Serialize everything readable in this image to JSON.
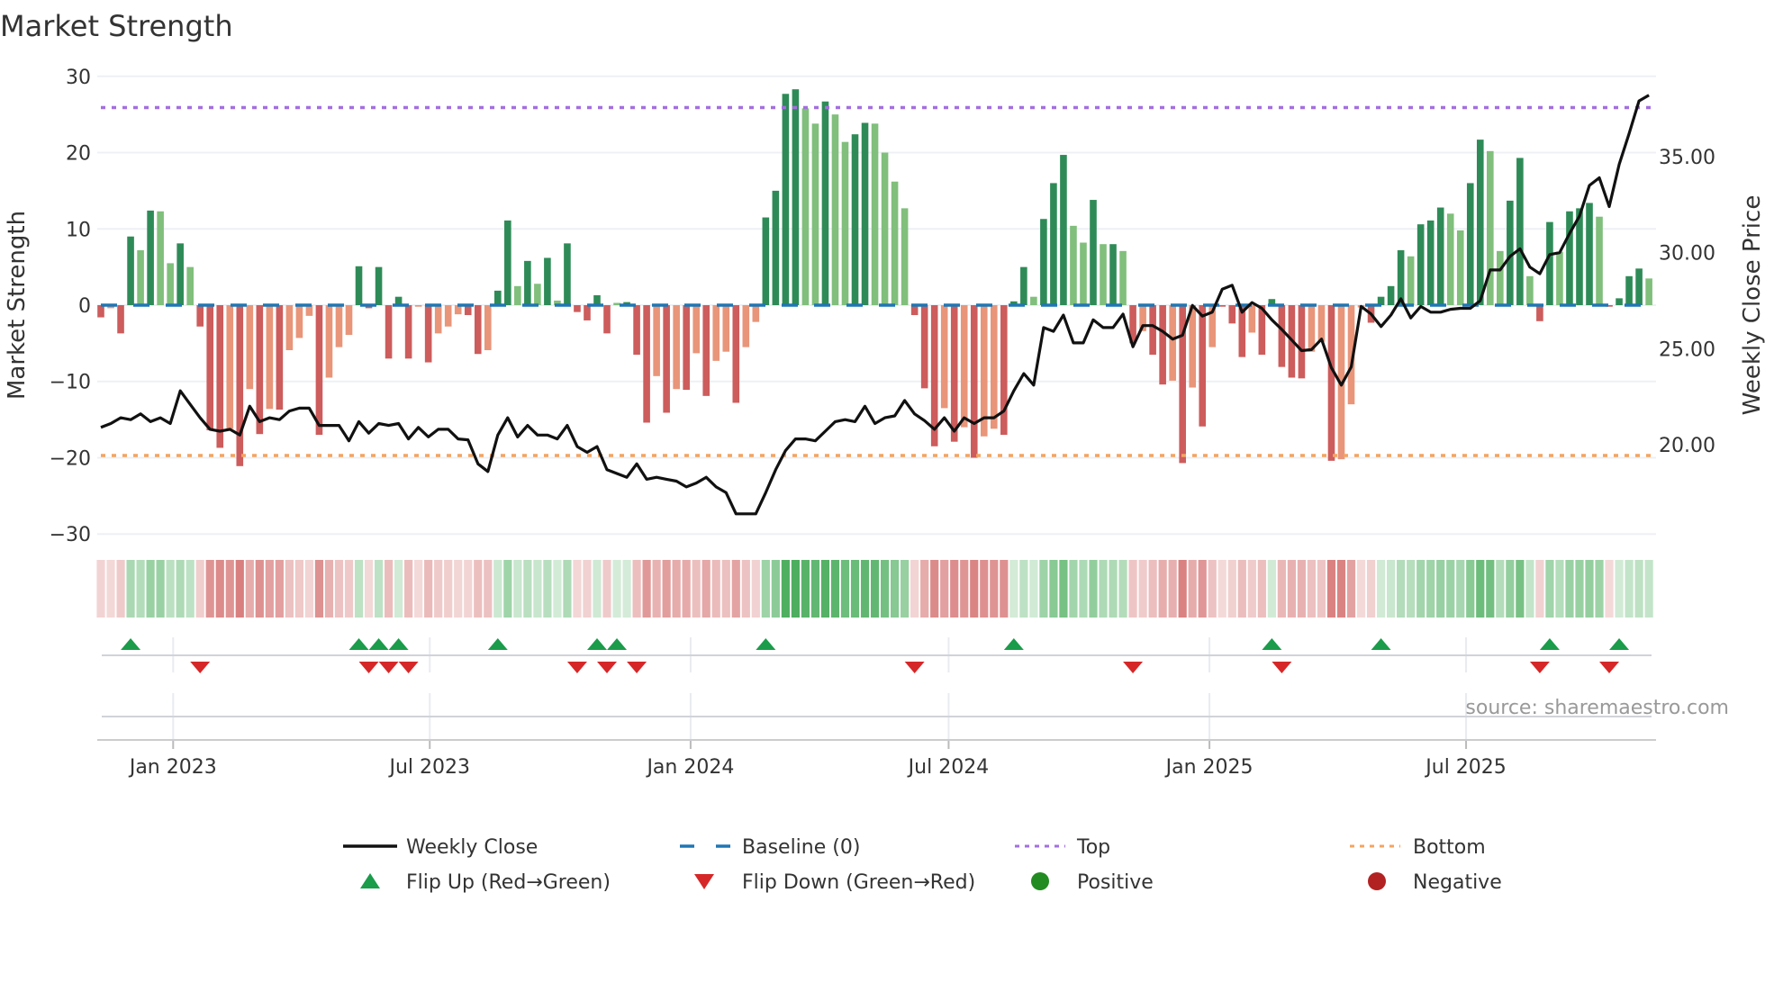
{
  "title": "Market Strength",
  "source": "source: sharemaestro.com",
  "colors": {
    "strong_positive": "#2e8b57",
    "weak_positive": "#80bf7c",
    "strong_negative": "#cd5c5c",
    "weak_negative": "#e8957a",
    "close_line": "#111111",
    "baseline": "#1f77b4",
    "top": "#a36fe0",
    "bottom": "#f4a460",
    "flip_up": "#1a9c4a",
    "flip_down": "#d62728",
    "positive": "#228b22",
    "negative": "#b22222",
    "heat_positive": "#2ea043",
    "heat_negative": "#c84646"
  },
  "legend": [
    {
      "key": "weekly-close",
      "label": "Weekly Close"
    },
    {
      "key": "baseline",
      "label": "Baseline (0)"
    },
    {
      "key": "top",
      "label": "Top"
    },
    {
      "key": "bottom",
      "label": "Bottom"
    },
    {
      "key": "flip-up",
      "label": "Flip Up (Red→Green)"
    },
    {
      "key": "flip-down",
      "label": "Flip Down (Green→Red)"
    },
    {
      "key": "positive",
      "label": "Positive"
    },
    {
      "key": "negative",
      "label": "Negative"
    }
  ],
  "chart_data": {
    "type": "bar",
    "title": "Market Strength",
    "ylabel": "Market Strength",
    "ylabel_right": "Weekly Close Price",
    "start_date": "2022-11-11",
    "frequency": "weekly",
    "ylim": [
      -30.8,
      30.8
    ],
    "ylim_right": [
      15.03,
      39.5
    ],
    "grid": true,
    "legend_position": "bottom",
    "yticks": [
      {
        "value": 30,
        "label": "30"
      },
      {
        "value": 20,
        "label": "20"
      },
      {
        "value": 10,
        "label": "10"
      },
      {
        "value": 0,
        "label": "0"
      },
      {
        "value": -10,
        "label": "−10"
      },
      {
        "value": -20,
        "label": "−20"
      },
      {
        "value": -30,
        "label": "−30"
      }
    ],
    "yticks_right": [
      {
        "value": 35,
        "label": "35.00"
      },
      {
        "value": 30,
        "label": "30.00"
      },
      {
        "value": 25,
        "label": "25.00"
      },
      {
        "value": 20,
        "label": "20.00"
      }
    ],
    "xticks": [
      {
        "date": "2023-01-01",
        "label": "Jan 2023"
      },
      {
        "date": "2023-07-01",
        "label": "Jul 2023"
      },
      {
        "date": "2024-01-01",
        "label": "Jan 2024"
      },
      {
        "date": "2024-07-01",
        "label": "Jul 2024"
      },
      {
        "date": "2025-01-01",
        "label": "Jan 2025"
      },
      {
        "date": "2025-07-01",
        "label": "Jul 2025"
      }
    ],
    "baseline": 0,
    "top_level": 25.9,
    "bottom_level": -19.7,
    "series": [
      {
        "name": "Market Strength",
        "type": "bar",
        "axis": "left",
        "values": [
          -1.6,
          -0.4,
          -3.7,
          9.0,
          7.2,
          12.4,
          12.3,
          5.5,
          8.1,
          5.0,
          -2.8,
          -16.4,
          -18.7,
          -16.2,
          -21.1,
          -11.0,
          -16.9,
          -13.6,
          -13.7,
          -5.9,
          -4.3,
          -1.4,
          -17.0,
          -9.5,
          -5.5,
          -3.9,
          5.1,
          -0.4,
          5.0,
          -7.0,
          1.1,
          -7.0,
          -0.2,
          -7.5,
          -3.7,
          -2.8,
          -1.2,
          -1.3,
          -6.4,
          -5.9,
          1.9,
          11.1,
          2.5,
          5.8,
          2.8,
          6.2,
          0.6,
          8.1,
          -0.9,
          -2.0,
          1.3,
          -3.7,
          0.3,
          0.4,
          -6.5,
          -15.4,
          -9.3,
          -14.1,
          -11.0,
          -11.1,
          -6.3,
          -11.9,
          -7.3,
          -6.1,
          -12.8,
          -5.5,
          -2.2,
          11.5,
          15.0,
          27.7,
          28.3,
          25.8,
          23.8,
          26.7,
          25.0,
          21.4,
          22.4,
          23.9,
          23.8,
          20.0,
          16.2,
          12.7,
          -1.3,
          -10.9,
          -18.5,
          -13.5,
          -17.9,
          -16.0,
          -20.0,
          -17.2,
          -16.2,
          -17.0,
          0.5,
          5.0,
          1.1,
          11.3,
          16.0,
          19.7,
          10.4,
          8.2,
          13.8,
          8.0,
          8.0,
          7.1,
          -5.0,
          -3.4,
          -6.5,
          -10.4,
          -9.9,
          -20.7,
          -10.8,
          -15.9,
          -5.5,
          -0.2,
          -2.4,
          -6.8,
          -3.6,
          -6.5,
          0.8,
          -8.1,
          -9.5,
          -9.6,
          -6.1,
          -4.8,
          -20.4,
          -20.2,
          -13.0,
          -0.3,
          -2.3,
          1.1,
          2.5,
          7.2,
          6.4,
          10.6,
          11.1,
          12.8,
          12.0,
          9.8,
          16.0,
          21.7,
          20.2,
          7.1,
          13.7,
          19.3,
          3.8,
          -2.1,
          10.9,
          7.0,
          12.3,
          12.7,
          13.4,
          11.6,
          -0.2,
          0.9,
          3.8,
          4.8,
          3.5
        ],
        "strong": [
          1,
          0,
          1,
          1,
          0,
          1,
          0,
          0,
          1,
          0,
          1,
          1,
          1,
          0,
          1,
          0,
          1,
          0,
          1,
          0,
          0,
          0,
          1,
          0,
          0,
          0,
          1,
          1,
          1,
          1,
          1,
          1,
          0,
          1,
          0,
          0,
          0,
          1,
          1,
          0,
          1,
          1,
          0,
          1,
          0,
          1,
          0,
          1,
          1,
          1,
          1,
          1,
          0,
          1,
          1,
          1,
          0,
          1,
          0,
          1,
          0,
          1,
          0,
          0,
          1,
          0,
          0,
          1,
          1,
          1,
          1,
          0,
          0,
          1,
          0,
          0,
          1,
          1,
          0,
          0,
          0,
          0,
          1,
          1,
          1,
          0,
          1,
          0,
          1,
          0,
          0,
          1,
          1,
          1,
          0,
          1,
          1,
          1,
          0,
          0,
          1,
          0,
          1,
          0,
          1,
          0,
          1,
          1,
          0,
          1,
          0,
          1,
          0,
          1,
          1,
          1,
          0,
          1,
          1,
          1,
          1,
          1,
          0,
          0,
          1,
          0,
          0,
          0,
          1,
          1,
          1,
          1,
          0,
          1,
          1,
          1,
          0,
          0,
          1,
          1,
          0,
          0,
          1,
          1,
          0,
          1,
          1,
          0,
          1,
          1,
          1,
          0,
          1,
          1,
          1,
          1,
          0
        ]
      },
      {
        "name": "Weekly Close",
        "type": "line",
        "axis": "right",
        "values": [
          20.9,
          21.1,
          21.4,
          21.3,
          21.6,
          21.2,
          21.4,
          21.1,
          22.8,
          22.1,
          21.4,
          20.8,
          20.7,
          20.8,
          20.5,
          22.0,
          21.2,
          21.4,
          21.3,
          21.75,
          21.9,
          21.9,
          21.0,
          21.0,
          21.0,
          20.2,
          21.2,
          20.6,
          21.1,
          21.0,
          21.1,
          20.3,
          20.9,
          20.4,
          20.8,
          20.8,
          20.3,
          20.25,
          19.0,
          18.6,
          20.5,
          21.4,
          20.4,
          21.0,
          20.5,
          20.5,
          20.3,
          21.0,
          19.9,
          19.6,
          19.9,
          18.7,
          18.5,
          18.3,
          19.0,
          18.2,
          18.3,
          18.2,
          18.1,
          17.8,
          18.0,
          18.3,
          17.8,
          17.5,
          16.4,
          16.4,
          16.4,
          17.5,
          18.7,
          19.7,
          20.3,
          20.3,
          20.2,
          20.7,
          21.2,
          21.3,
          21.2,
          22.0,
          21.1,
          21.4,
          21.5,
          22.3,
          21.6,
          21.25,
          20.8,
          21.4,
          20.7,
          21.4,
          21.1,
          21.4,
          21.4,
          21.75,
          22.8,
          23.7,
          23.1,
          26.1,
          25.9,
          26.75,
          25.3,
          25.3,
          26.5,
          26.1,
          26.1,
          26.8,
          25.1,
          26.2,
          26.2,
          25.9,
          25.5,
          25.7,
          27.25,
          26.7,
          26.9,
          28.1,
          28.3,
          26.9,
          27.4,
          27.1,
          26.5,
          26.0,
          25.45,
          24.9,
          24.95,
          25.5,
          24.0,
          23.1,
          24.05,
          27.2,
          26.8,
          26.15,
          26.75,
          27.6,
          26.6,
          27.2,
          26.9,
          26.9,
          27.05,
          27.1,
          27.1,
          27.5,
          29.1,
          29.1,
          29.8,
          30.2,
          29.25,
          28.9,
          29.9,
          30.0,
          31.0,
          31.9,
          33.5,
          33.9,
          32.4,
          34.6,
          36.2,
          37.9,
          38.2
        ]
      }
    ],
    "flip_up_weeks": [
      4,
      27,
      29,
      31,
      41,
      51,
      53,
      68,
      93,
      119,
      130,
      147,
      154
    ],
    "flip_down_weeks": [
      11,
      28,
      30,
      32,
      49,
      52,
      55,
      83,
      105,
      120,
      146,
      153
    ]
  }
}
